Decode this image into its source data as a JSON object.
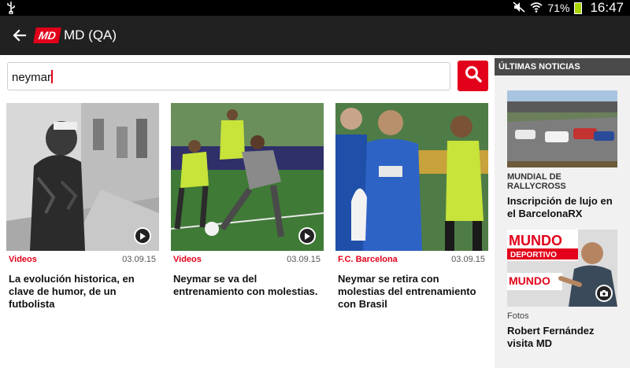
{
  "status_bar": {
    "battery_percent": "71%",
    "time": "16:47",
    "icons": [
      "usb-icon",
      "mute-icon",
      "wifi-icon",
      "battery-icon"
    ]
  },
  "app_bar": {
    "logo_text": "MD",
    "title": "MD (QA)"
  },
  "search": {
    "value": "neymar",
    "button_icon": "search-icon"
  },
  "results": [
    {
      "section": "Videos",
      "date": "03.09.15",
      "headline": "La evolución historica, en clave de humor, de un futbolista",
      "media_icon": "play-icon"
    },
    {
      "section": "Videos",
      "date": "03.09.15",
      "headline": "Neymar se va del entrenamiento con molestias.",
      "media_icon": "play-icon"
    },
    {
      "section": "F.C. Barcelona",
      "date": "03.09.15",
      "headline": "Neymar se retira con molestias del entrenamiento con Brasil",
      "media_icon": ""
    }
  ],
  "sidebar": {
    "header": "ÚLTIMAS NOTICIAS",
    "items": [
      {
        "kicker": "MUNDIAL DE RALLYCROSS",
        "title": "Inscripción de lujo en el BarcelonaRX"
      },
      {
        "kicker": "Fotos",
        "title": "Robert Fernández visita MD",
        "media_icon": "camera-icon"
      }
    ]
  },
  "colors": {
    "brand_red": "#e2001a",
    "app_bar": "#212121",
    "sidebar_bg": "#f1f1f1",
    "sidebar_header": "#4a4a4a"
  }
}
